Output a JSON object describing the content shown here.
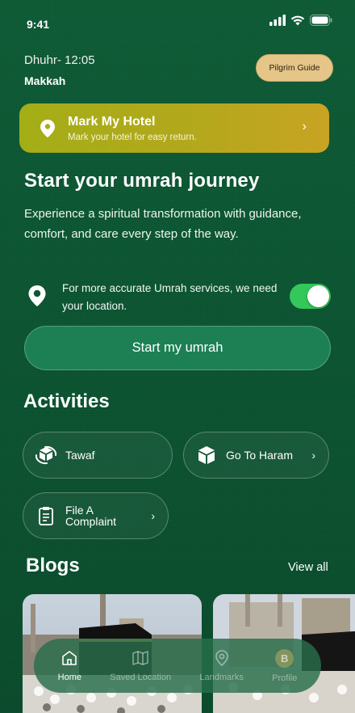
{
  "status": {
    "time": "9:41"
  },
  "header": {
    "prayer": "Dhuhr- 12:05",
    "city": "Makkah",
    "pilgrim_guide": "Pilgrim Guide"
  },
  "hotel_card": {
    "title": "Mark My Hotel",
    "subtitle": "Mark your hotel for easy return."
  },
  "hero": {
    "title": "Start your umrah journey",
    "description": "Experience a spiritual transformation with guidance, comfort, and care every step of the way."
  },
  "location": {
    "text": "For more accurate Umrah services, we need your location.",
    "enabled": true
  },
  "start_button": "Start my umrah",
  "activities": {
    "title": "Activities",
    "items": [
      "Tawaf",
      "Go To Haram",
      "File A Complaint"
    ]
  },
  "blogs": {
    "title": "Blogs",
    "view_all": "View all"
  },
  "nav": {
    "items": [
      "Home",
      "Saved Location",
      "Landmarks",
      "Profile"
    ],
    "avatar_initial": "B",
    "active": "Home"
  },
  "colors": {
    "background": "#0f5a35",
    "toggle_on": "#34c759",
    "pilgrim_btn": "#e5c588",
    "start_btn": "#1c8054"
  }
}
